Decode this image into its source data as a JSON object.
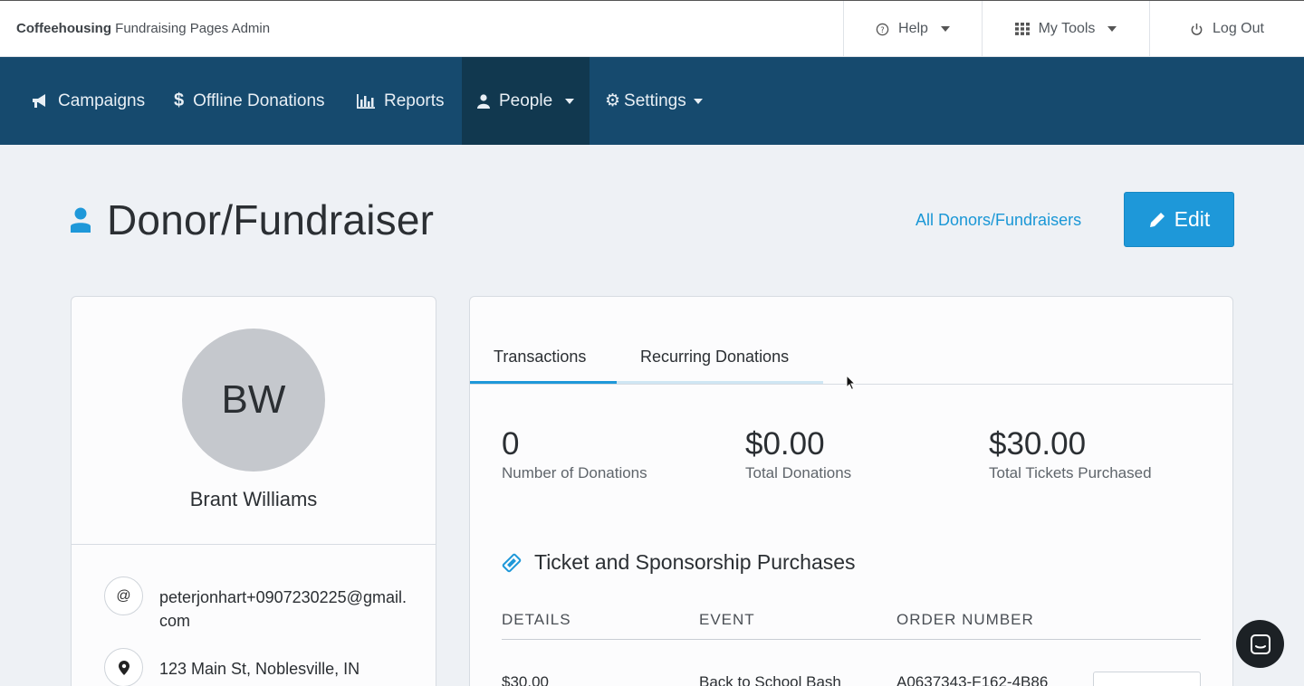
{
  "topbar": {
    "brand_bold": "Coffeehousing",
    "brand_rest": "Fundraising Pages Admin",
    "help_label": "Help",
    "tools_label": "My Tools",
    "logout_label": "Log Out"
  },
  "nav": {
    "items": [
      {
        "label": "Campaigns",
        "icon": "megaphone-icon"
      },
      {
        "label": "Offline Donations",
        "icon": "dollar-icon"
      },
      {
        "label": "Reports",
        "icon": "bar-chart-icon"
      },
      {
        "label": "People",
        "icon": "user-icon",
        "active": true
      },
      {
        "label": "Settings",
        "icon": "gear-icon"
      }
    ]
  },
  "page": {
    "title": "Donor/Fundraiser",
    "all_link": "All Donors/Fundraisers",
    "edit_label": "Edit"
  },
  "profile": {
    "initials": "BW",
    "name": "Brant Williams",
    "email": "peterjonhart+0907230225@gmail.com",
    "address": "123 Main St, Noblesville, IN"
  },
  "tabs": [
    "Transactions",
    "Recurring Donations"
  ],
  "stats": [
    {
      "value": "0",
      "label": "Number of Donations"
    },
    {
      "value": "$0.00",
      "label": "Total Donations"
    },
    {
      "value": "$30.00",
      "label": "Total Tickets Purchased"
    }
  ],
  "tickets": {
    "title": "Ticket and Sponsorship Purchases",
    "columns": [
      "DETAILS",
      "EVENT",
      "ORDER NUMBER"
    ],
    "rows": [
      {
        "details": "$30.00",
        "event": "Back to School Bash",
        "order": "A0637343-F162-4B86"
      }
    ]
  },
  "colors": {
    "nav_bg": "#164a6e",
    "nav_active": "#11384f",
    "accent": "#1e98d9",
    "page_bg": "#eef1f5"
  }
}
